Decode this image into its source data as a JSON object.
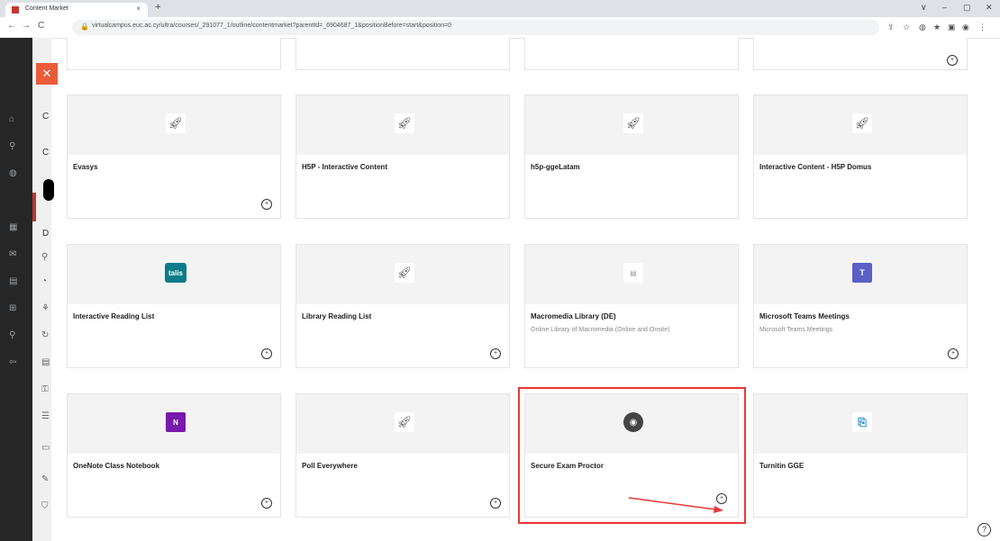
{
  "browser": {
    "tab_title": "Content Market",
    "tab_close": "×",
    "new_tab": "+",
    "url": "virtualcampus.euc.ac.cy/ultra/courses/_291077_1/outline/contentmarket?parentId=_6904687_1&positionBefore=start&position=0",
    "window_controls": [
      "∨",
      "–",
      "▢",
      "✕"
    ]
  },
  "cards": [
    {
      "title": "Evasys",
      "description": "",
      "logo": "rocket-icon"
    },
    {
      "title": "H5P - Interactive Content",
      "description": "",
      "logo": "rocket-icon"
    },
    {
      "title": "h5p-ggeLatam",
      "description": "",
      "logo": "rocket-icon"
    },
    {
      "title": "Interactive Content - H5P Domus",
      "description": "",
      "logo": "rocket-icon"
    },
    {
      "title": "Interactive Reading List",
      "description": "",
      "logo": "talis-logo",
      "logo_text": "talis"
    },
    {
      "title": "Library Reading List",
      "description": "",
      "logo": "rocket-icon"
    },
    {
      "title": "Macromedia Library (DE)",
      "description": "Online Library of Macromedia (Online and Onsite)",
      "logo": "macromedia-logo"
    },
    {
      "title": "Microsoft Teams Meetings",
      "description": "Microsoft Teams Meetings",
      "logo": "teams-logo"
    },
    {
      "title": "OneNote Class Notebook",
      "description": "",
      "logo": "onenote-logo"
    },
    {
      "title": "Poll Everywhere",
      "description": "",
      "logo": "rocket-icon"
    },
    {
      "title": "Secure Exam Proctor",
      "description": "",
      "logo": "webcam-logo"
    },
    {
      "title": "Turnitin GGE",
      "description": "",
      "logo": "turnitin-logo"
    }
  ],
  "colors": {
    "highlight": "#e53935",
    "close_button": "#ea5b3a",
    "teams": "#5b5fc7",
    "onenote": "#7719aa",
    "talis": "#0c7c8a",
    "turnitin": "#2b8ad1"
  }
}
